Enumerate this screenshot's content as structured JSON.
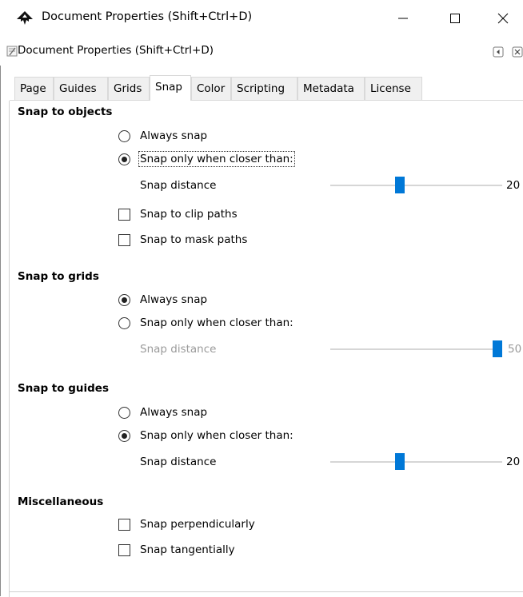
{
  "window": {
    "title": "Document Properties (Shift+Ctrl+D)",
    "minimize": "—",
    "maximize": "☐",
    "close": "✕"
  },
  "dock": {
    "title": "Document Properties (Shift+Ctrl+D)"
  },
  "tabs": [
    {
      "label": "Page",
      "active": false
    },
    {
      "label": "Guides",
      "active": false
    },
    {
      "label": "Grids",
      "active": false
    },
    {
      "label": "Snap",
      "active": true
    },
    {
      "label": "Color",
      "active": false
    },
    {
      "label": "Scripting",
      "active": false
    },
    {
      "label": "Metadata",
      "active": false
    },
    {
      "label": "License",
      "active": false
    }
  ],
  "objects": {
    "title": "Snap to objects",
    "always_snap": "Always snap",
    "snap_closer": "Snap only when closer than:",
    "snap_distance": "Snap distance",
    "distance_value": "20",
    "clip_paths": "Snap to clip paths",
    "mask_paths": "Snap to mask paths",
    "selected": "snap_closer",
    "slider_fraction": 0.4
  },
  "grids": {
    "title": "Snap to grids",
    "always_snap": "Always snap",
    "snap_closer": "Snap only when closer than:",
    "snap_distance": "Snap distance",
    "distance_value": "50",
    "selected": "always_snap",
    "slider_fraction": 1.0,
    "disabled": true
  },
  "guides": {
    "title": "Snap to guides",
    "always_snap": "Always snap",
    "snap_closer": "Snap only when closer than:",
    "snap_distance": "Snap distance",
    "distance_value": "20",
    "selected": "snap_closer",
    "slider_fraction": 0.4
  },
  "misc": {
    "title": "Miscellaneous",
    "perpendicular": "Snap perpendicularly",
    "tangential": "Snap tangentially"
  },
  "colors": {
    "slider_thumb": "#0078d7",
    "disabled_text": "#9a9a9a"
  }
}
